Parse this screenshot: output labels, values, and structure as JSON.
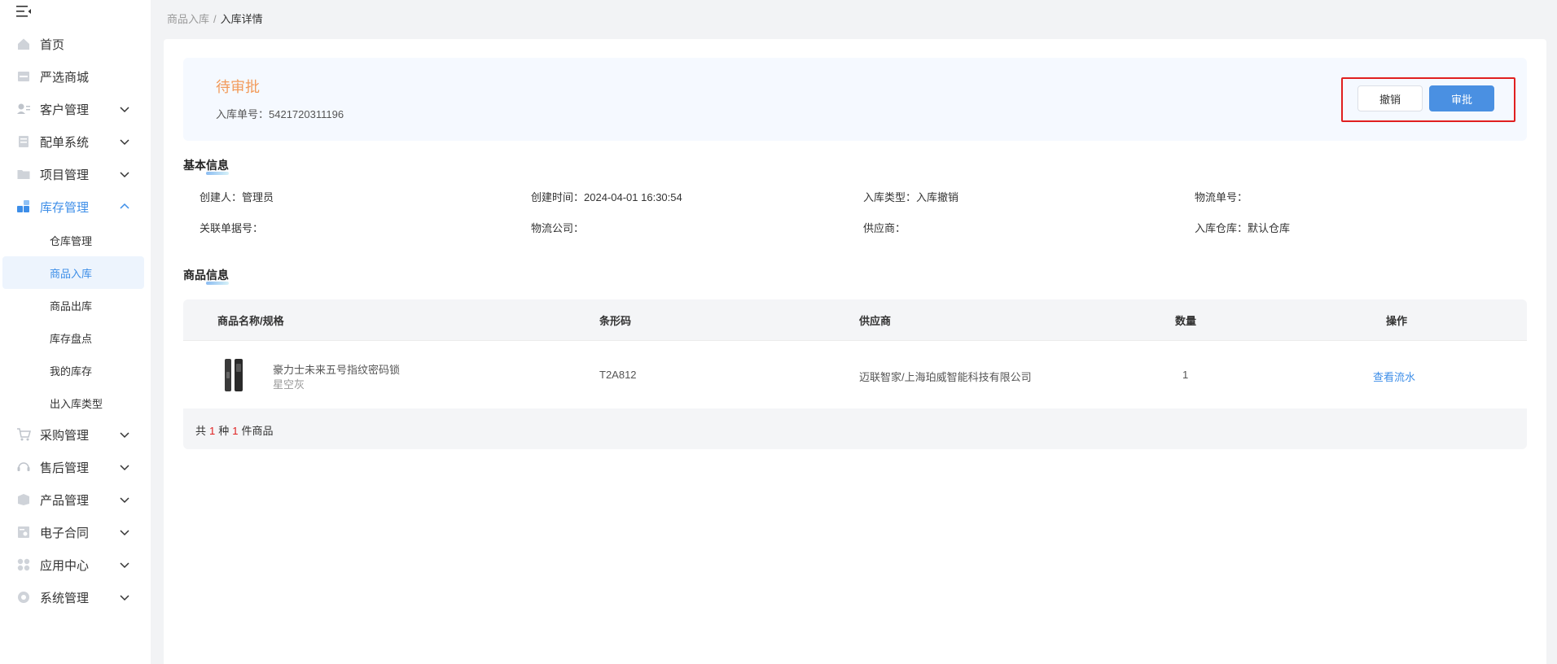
{
  "sidebar": {
    "items": [
      {
        "label": "首页",
        "icon": "home-icon"
      },
      {
        "label": "严选商城",
        "icon": "shop-icon"
      },
      {
        "label": "客户管理",
        "icon": "customer-icon"
      },
      {
        "label": "配单系统",
        "icon": "order-icon"
      },
      {
        "label": "项目管理",
        "icon": "folder-icon"
      },
      {
        "label": "库存管理",
        "icon": "inventory-icon"
      },
      {
        "label": "采购管理",
        "icon": "cart-icon"
      },
      {
        "label": "售后管理",
        "icon": "headset-icon"
      },
      {
        "label": "产品管理",
        "icon": "box-icon"
      },
      {
        "label": "电子合同",
        "icon": "contract-icon"
      },
      {
        "label": "应用中心",
        "icon": "apps-icon"
      },
      {
        "label": "系统管理",
        "icon": "settings-icon"
      }
    ],
    "sub_items": [
      {
        "label": "仓库管理"
      },
      {
        "label": "商品入库"
      },
      {
        "label": "商品出库"
      },
      {
        "label": "库存盘点"
      },
      {
        "label": "我的库存"
      },
      {
        "label": "出入库类型"
      }
    ]
  },
  "breadcrumb": {
    "parent": "商品入库",
    "separator": "/",
    "current": "入库详情"
  },
  "status": {
    "title": "待审批",
    "order_label": "入库单号：",
    "order_no": "5421720311196"
  },
  "actions": {
    "cancel": "撤销",
    "approve": "审批"
  },
  "basic_info": {
    "title": "基本信息",
    "fields": [
      {
        "label": "创建人：",
        "value": "管理员"
      },
      {
        "label": "创建时间：",
        "value": "2024-04-01 16:30:54"
      },
      {
        "label": "入库类型：",
        "value": "入库撤销"
      },
      {
        "label": "物流单号：",
        "value": ""
      },
      {
        "label": "关联单据号：",
        "value": ""
      },
      {
        "label": "物流公司：",
        "value": ""
      },
      {
        "label": "供应商：",
        "value": ""
      },
      {
        "label": "入库仓库：",
        "value": "默认仓库"
      }
    ]
  },
  "goods_info": {
    "title": "商品信息",
    "columns": [
      "商品名称/规格",
      "条形码",
      "供应商",
      "数量",
      "操作"
    ],
    "rows": [
      {
        "name": "豪力士未来五号指纹密码锁",
        "spec": "星空灰",
        "barcode": "T2A812",
        "supplier": "迈联智家/上海珀威智能科技有限公司",
        "quantity": "1",
        "action": "查看流水"
      }
    ],
    "footer": {
      "prefix": "共",
      "kinds": "1",
      "mid": "种",
      "count": "1",
      "suffix": "件商品"
    }
  },
  "colors": {
    "accent": "#3d8ee8",
    "status": "#f29b5b",
    "highlight": "#e02020"
  }
}
